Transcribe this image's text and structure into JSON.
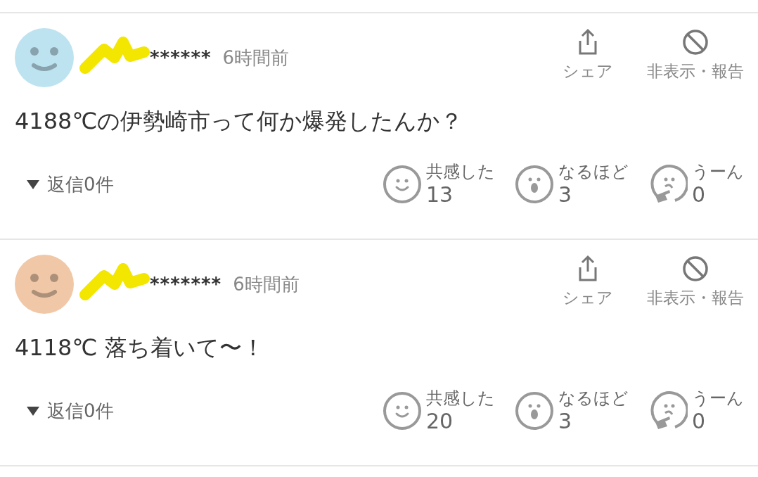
{
  "comments": [
    {
      "color": "#bde3f0",
      "username": "******",
      "time": "6時間前",
      "share": "シェア",
      "hide": "非表示・報告",
      "text": "4188℃の伊勢崎市って何か爆発したんか？",
      "replies": "返信0件",
      "reactions": [
        {
          "kind": "smile",
          "label": "共感した",
          "count": "13"
        },
        {
          "kind": "surprise",
          "label": "なるほど",
          "count": "3"
        },
        {
          "kind": "think",
          "label": "うーん",
          "count": "0"
        }
      ]
    },
    {
      "color": "#f0c8a8",
      "username": "*******",
      "time": "6時間前",
      "share": "シェア",
      "hide": "非表示・報告",
      "text": "4118℃ 落ち着いて〜！",
      "replies": "返信0件",
      "reactions": [
        {
          "kind": "smile",
          "label": "共感した",
          "count": "20"
        },
        {
          "kind": "surprise",
          "label": "なるほど",
          "count": "3"
        },
        {
          "kind": "think",
          "label": "うーん",
          "count": "0"
        }
      ]
    }
  ]
}
